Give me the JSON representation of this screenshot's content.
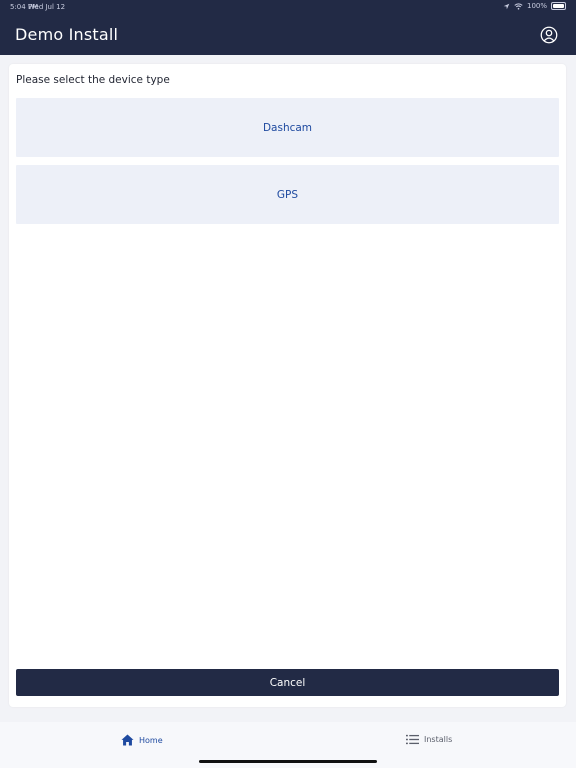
{
  "status_bar": {
    "time": "5:04 PM",
    "date": "Wed Jul 12",
    "battery": "100%"
  },
  "header": {
    "title": "Demo Install",
    "profile_icon": "user-circle-icon"
  },
  "content": {
    "prompt": "Please select the device type",
    "options": [
      {
        "label": "Dashcam"
      },
      {
        "label": "GPS"
      }
    ],
    "cancel_label": "Cancel"
  },
  "tabbar": {
    "tabs": [
      {
        "label": "Home",
        "icon": "home-icon",
        "active": true
      },
      {
        "label": "Installs",
        "icon": "list-icon",
        "active": false
      }
    ]
  },
  "colors": {
    "header_bg": "#222a45",
    "accent": "#1f4aa0",
    "option_bg": "#edf0f8",
    "page_bg": "#f2f3f7"
  }
}
